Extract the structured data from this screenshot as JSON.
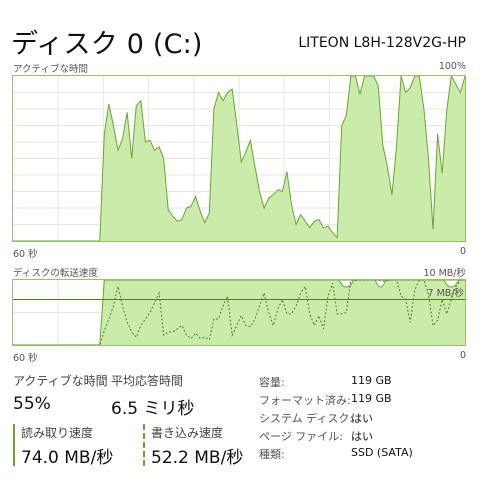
{
  "header": {
    "title": "ディスク 0 (C:)",
    "model": "LITEON L8H-128V2G-HP"
  },
  "active_chart": {
    "label": "アクティブな時間",
    "max_label": "100%",
    "time_left": "60 秒",
    "time_right": "0"
  },
  "transfer_chart": {
    "label": "ディスクの転送速度",
    "max_label": "10 MB/秒",
    "ref_label": "7 MB/秒",
    "time_left": "60 秒",
    "time_right": "0"
  },
  "stats": {
    "active_time_label": "アクティブな時間",
    "active_time_value": "55%",
    "response_label": "平均応答時間",
    "response_value": "6.5 ミリ秒",
    "read_label": "読み取り速度",
    "read_value": "74.0 MB/秒",
    "write_label": "書き込み速度",
    "write_value": "52.2 MB/秒"
  },
  "properties": [
    {
      "label": "容量:",
      "value": "119 GB"
    },
    {
      "label": "フォーマット済み:",
      "value": "119 GB"
    },
    {
      "label": "システム ディスク:",
      "value": "はい"
    },
    {
      "label": "ページ ファイル:",
      "value": "はい"
    },
    {
      "label": "種類:",
      "value": "SSD (SATA)"
    }
  ],
  "colors": {
    "accent": "#6aa62e",
    "fill": "#c9ecab",
    "grid": "#e4ead9"
  },
  "chart_data": [
    {
      "type": "area",
      "series": [
        {
          "name": "アクティブな時間",
          "values": [
            0,
            0,
            0,
            0,
            0,
            0,
            0,
            0,
            0,
            0,
            0,
            0,
            0,
            0,
            0,
            0,
            0,
            0,
            0,
            0,
            0,
            0,
            0,
            0,
            0,
            0,
            0,
            0,
            0,
            0,
            0,
            0,
            0,
            0,
            0,
            0,
            0,
            0,
            0,
            0,
            0,
            0,
            0,
            0,
            0,
            0,
            0,
            0,
            0,
            0,
            0,
            0,
            0,
            0,
            0,
            0,
            0,
            0,
            0,
            0,
            0
          ]
        }
      ],
      "ylim": [
        0,
        100
      ]
    }
  ],
  "active_series": [
    0,
    0,
    0,
    0,
    0,
    0,
    0,
    0,
    0,
    0,
    0,
    0,
    0,
    0,
    0,
    0,
    0,
    0,
    0,
    0,
    65,
    83,
    70,
    55,
    62,
    78,
    50,
    82,
    85,
    60,
    61,
    55,
    57,
    50,
    19,
    15,
    12,
    13,
    20,
    21,
    27,
    18,
    11,
    17,
    80,
    90,
    85,
    90,
    92,
    71,
    48,
    54,
    61,
    45,
    30,
    20,
    26,
    28,
    31,
    30,
    42,
    22,
    10,
    16,
    12,
    8,
    12,
    13,
    8,
    9,
    5,
    2,
    70,
    76,
    100,
    100,
    89,
    100,
    100,
    100,
    94,
    58,
    45,
    28,
    57,
    100,
    90,
    93,
    100,
    100,
    80,
    50,
    7,
    65,
    41,
    79,
    100,
    95,
    90,
    100
  ],
  "read_series": [
    0,
    0,
    0,
    0,
    0,
    0,
    0,
    0,
    0,
    0,
    0,
    0,
    0,
    0,
    0,
    0,
    0,
    0,
    0,
    0,
    100,
    100,
    100,
    100,
    100,
    100,
    100,
    100,
    100,
    100,
    100,
    100,
    100,
    100,
    100,
    100,
    100,
    100,
    100,
    100,
    100,
    100,
    100,
    100,
    100,
    100,
    100,
    100,
    100,
    100,
    100,
    100,
    100,
    100,
    100,
    100,
    100,
    100,
    100,
    100,
    100,
    100,
    100,
    100,
    100,
    100,
    100,
    100,
    100,
    100,
    100,
    100,
    100,
    100,
    100,
    100,
    100,
    100,
    100,
    100,
    100,
    100,
    100,
    100,
    100,
    100,
    100,
    100,
    100,
    100,
    100,
    100,
    100,
    100,
    100,
    100,
    100,
    100,
    100,
    100
  ],
  "read_dips": [
    [
      95,
      97,
      0,
      96,
      100,
      95
    ],
    [
      72,
      74,
      80,
      97,
      100,
      97
    ],
    [
      80,
      81,
      95,
      100,
      100,
      98
    ]
  ],
  "write_series": [
    0,
    0,
    0,
    0,
    0,
    0,
    0,
    0,
    0,
    0,
    0,
    0,
    0,
    0,
    0,
    0,
    0,
    0,
    0,
    0,
    22,
    40,
    60,
    90,
    60,
    35,
    20,
    12,
    30,
    40,
    50,
    65,
    80,
    15,
    20,
    20,
    25,
    30,
    15,
    10,
    18,
    10,
    12,
    8,
    40,
    40,
    60,
    75,
    15,
    30,
    45,
    30,
    28,
    40,
    60,
    80,
    50,
    30,
    55,
    70,
    48,
    48,
    60,
    80,
    90,
    48,
    30,
    45,
    25,
    75,
    95,
    48,
    48,
    50,
    100,
    99,
    100,
    100,
    100,
    100,
    100,
    98,
    99,
    100,
    100,
    75,
    70,
    35,
    85,
    100,
    100,
    78,
    30,
    38,
    70,
    48,
    70,
    90,
    100,
    100
  ]
}
